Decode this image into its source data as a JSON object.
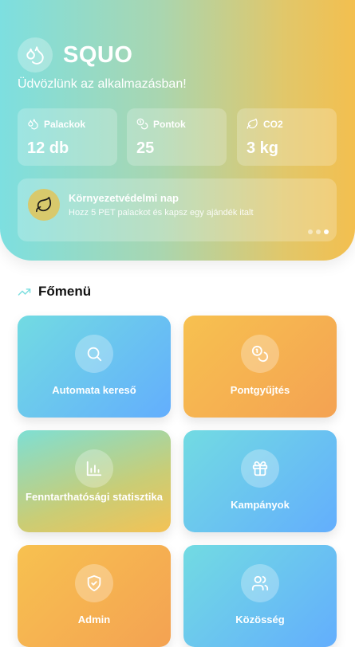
{
  "app": {
    "name": "SQUO",
    "welcome": "Üdvözlünk az alkalmazásban!"
  },
  "stats": [
    {
      "label": "Palackok",
      "value": "12 db",
      "icon": "drops-icon"
    },
    {
      "label": "Pontok",
      "value": "25",
      "icon": "coins-icon"
    },
    {
      "label": "CO2",
      "value": "3 kg",
      "icon": "leaf-icon"
    }
  ],
  "banner": {
    "title": "Környezetvédelmi nap",
    "subtitle": "Hozz 5 PET palackot és kapsz egy ajándék italt",
    "icon": "leaf-icon",
    "slide_count": 3,
    "active_slide": 3
  },
  "menu": {
    "title": "Főmenü",
    "items": [
      {
        "label": "Automata kereső",
        "icon": "search-icon"
      },
      {
        "label": "Pontgyűjtés",
        "icon": "coins-icon"
      },
      {
        "label": "Fenntarthatósági statisztika",
        "icon": "bar-chart-icon"
      },
      {
        "label": "Kampányok",
        "icon": "gift-icon"
      },
      {
        "label": "Admin",
        "icon": "shield-check-icon"
      },
      {
        "label": "Közösség",
        "icon": "users-icon"
      }
    ]
  },
  "colors": {
    "accent_teal": "#7ddfe0",
    "accent_yellow": "#f3bf4f",
    "accent_blue": "#63aefd",
    "accent_orange": "#f4a252"
  }
}
